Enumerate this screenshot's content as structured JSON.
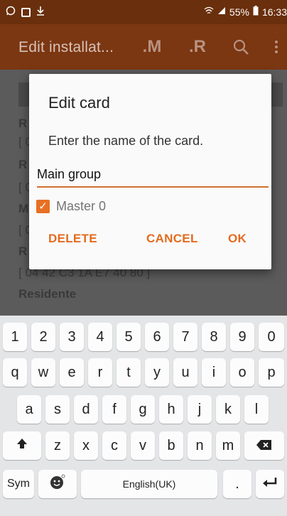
{
  "status_bar": {
    "left_icons": [
      "whatsapp-icon",
      "gallery-icon",
      "download-icon"
    ],
    "right_icons": [
      "wifi-icon",
      "signal-icon",
      "battery-icon"
    ],
    "battery": "55%",
    "time": "16:33"
  },
  "action_bar": {
    "title": "Edit installat...",
    "m_button": ".M",
    "r_button": ".R",
    "search_icon": "search-icon",
    "menu_icon": "more-vert-icon"
  },
  "background": {
    "lines": [
      "R",
      "[ 0",
      "R",
      "[ 0",
      "M",
      "[ 0",
      "R",
      "[ 04 42 C3 1A E7 40 80 ]",
      "Residente"
    ]
  },
  "dialog": {
    "title": "Edit card",
    "message": "Enter the name of the card.",
    "input_value": "Main group",
    "checkbox_label": "Master 0",
    "checkbox_checked": true,
    "delete_label": "DELETE",
    "cancel_label": "CANCEL",
    "ok_label": "OK",
    "accent_color": "#E36B1F"
  },
  "keyboard": {
    "row1": [
      "1",
      "2",
      "3",
      "4",
      "5",
      "6",
      "7",
      "8",
      "9",
      "0"
    ],
    "row2": [
      "q",
      "w",
      "e",
      "r",
      "t",
      "y",
      "u",
      "i",
      "o",
      "p"
    ],
    "row3": [
      "a",
      "s",
      "d",
      "f",
      "g",
      "h",
      "j",
      "k",
      "l"
    ],
    "row4": [
      "z",
      "x",
      "c",
      "v",
      "b",
      "n",
      "m"
    ],
    "shift_icon": "shift-icon",
    "backspace_icon": "backspace-icon",
    "sym_label": "Sym",
    "emoji_icon": "emoji-icon",
    "space_label": "English(UK)",
    "period_label": ".",
    "enter_icon": "enter-icon"
  }
}
